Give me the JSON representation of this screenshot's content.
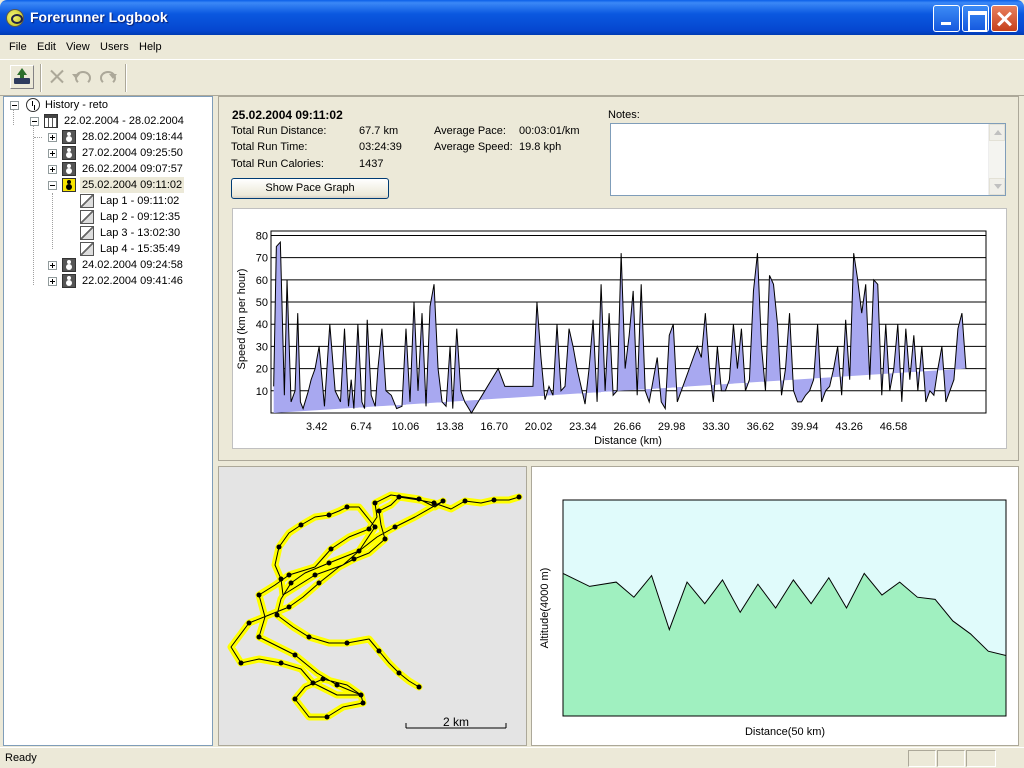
{
  "window": {
    "title": "Forerunner Logbook",
    "icon": "forerunner-app-icon"
  },
  "menu": [
    "File",
    "Edit",
    "View",
    "Users",
    "Help"
  ],
  "toolbar": {
    "buttons": [
      {
        "name": "upload-from-device",
        "icon": "upload-icon",
        "enabled": true
      },
      {
        "name": "delete",
        "icon": "delete-x-icon",
        "enabled": false
      },
      {
        "name": "undo",
        "icon": "undo-icon",
        "enabled": false
      },
      {
        "name": "redo",
        "icon": "redo-icon",
        "enabled": false
      }
    ]
  },
  "tree": {
    "root": "History - reto",
    "week": "22.02.2004 - 28.02.2004",
    "runs": [
      {
        "label": "28.02.2004 09:18:44",
        "expanded": false
      },
      {
        "label": "27.02.2004 09:25:50",
        "expanded": false
      },
      {
        "label": "26.02.2004 09:07:57",
        "expanded": false
      },
      {
        "label": "25.02.2004 09:11:02",
        "expanded": true,
        "selected": true
      },
      {
        "label": "24.02.2004 09:24:58",
        "expanded": false
      },
      {
        "label": "22.02.2004 09:41:46",
        "expanded": false
      }
    ],
    "laps": [
      "Lap 1 - 09:11:02",
      "Lap 2 - 09:12:35",
      "Lap 3 - 13:02:30",
      "Lap 4 - 15:35:49"
    ]
  },
  "details": {
    "title": "25.02.2004  09:11:02",
    "distance_label": "Total Run Distance:",
    "distance_value": "67.7 km",
    "time_label": "Total Run Time:",
    "time_value": "03:24:39",
    "calories_label": "Total Run Calories:",
    "calories_value": "1437",
    "pace_label": "Average Pace:",
    "pace_value": "00:03:01/km",
    "speed_label": "Average Speed:",
    "speed_value": "19.8 kph",
    "notes_label": "Notes:",
    "notes_value": "",
    "pace_button": "Show Pace Graph"
  },
  "map": {
    "scale_label": "2 km"
  },
  "status": {
    "text": "Ready"
  },
  "colors": {
    "speed_fill": "#a8a8f0",
    "speed_line": "#000000",
    "altitude_sky": "#e0fbfb",
    "altitude_fill": "#a0f0c0",
    "track": "#ffff00"
  },
  "chart_data": [
    {
      "type": "area",
      "title": "",
      "xlabel": "Distance (km)",
      "ylabel": "Speed (km per hour)",
      "ylim": [
        0,
        82
      ],
      "xlim": [
        0,
        53.5
      ],
      "grid": true,
      "yticks": [
        10,
        20,
        30,
        40,
        50,
        60,
        70,
        80
      ],
      "xticks": [
        "3.42",
        "6.74",
        "10.06",
        "13.38",
        "16.70",
        "20.02",
        "23.34",
        "26.66",
        "29.98",
        "33.30",
        "36.62",
        "39.94",
        "43.26",
        "46.58"
      ],
      "x": [
        0.2,
        0.4,
        0.7,
        1.0,
        1.2,
        1.5,
        1.8,
        2.0,
        2.2,
        2.4,
        2.6,
        2.8,
        3.0,
        3.3,
        3.6,
        4.0,
        4.4,
        4.8,
        5.2,
        5.5,
        5.8,
        6.0,
        6.2,
        6.5,
        6.8,
        7.0,
        7.2,
        7.5,
        7.8,
        8.0,
        8.3,
        8.6,
        9.0,
        9.4,
        9.8,
        10.1,
        10.4,
        10.7,
        11.0,
        11.3,
        11.6,
        11.9,
        12.2,
        12.5,
        12.8,
        13.1,
        13.4,
        13.6,
        13.9,
        14.2,
        14.5,
        15.0,
        15.5,
        16.0,
        16.5,
        17.0,
        17.5,
        18.0,
        18.6,
        19.2,
        19.6,
        19.9,
        20.2,
        20.5,
        20.8,
        21.1,
        21.4,
        21.7,
        22.0,
        22.3,
        22.6,
        22.9,
        23.2,
        23.5,
        23.8,
        24.1,
        24.4,
        24.7,
        25.0,
        25.3,
        25.6,
        25.9,
        26.2,
        26.5,
        26.8,
        27.1,
        27.4,
        27.7,
        28.0,
        28.3,
        28.6,
        28.9,
        29.2,
        29.5,
        29.8,
        30.1,
        30.4,
        30.7,
        31.0,
        31.3,
        31.6,
        31.9,
        32.2,
        32.5,
        32.8,
        33.1,
        33.4,
        33.7,
        34.0,
        34.3,
        34.6,
        34.9,
        35.2,
        35.5,
        35.8,
        36.1,
        36.4,
        36.7,
        37.0,
        37.3,
        37.6,
        37.9,
        38.2,
        38.5,
        38.8,
        39.1,
        39.4,
        39.7,
        40.0,
        40.3,
        40.6,
        40.9,
        41.2,
        41.5,
        41.8,
        42.1,
        42.4,
        42.7,
        43.0,
        43.3,
        43.6,
        43.9,
        44.2,
        44.5,
        44.8,
        45.1,
        45.4,
        45.7,
        46.0,
        46.3,
        46.6,
        46.9,
        47.2,
        47.5,
        47.8,
        48.1,
        48.4,
        48.7,
        49.0,
        49.3,
        49.6,
        49.9,
        50.2,
        50.5,
        50.8,
        51.1,
        51.4,
        51.7,
        52.0,
        52.3,
        52.6,
        52.9,
        53.2
      ],
      "series": [
        {
          "values": [
            12,
            75,
            77,
            8,
            60,
            5,
            10,
            45,
            5,
            2,
            6,
            10,
            15,
            20,
            30,
            3,
            40,
            10,
            5,
            38,
            3,
            15,
            2,
            40,
            5,
            2,
            42,
            8,
            3,
            20,
            38,
            10,
            8,
            2,
            3,
            38,
            5,
            50,
            10,
            45,
            3,
            48,
            58,
            20,
            5,
            3,
            30,
            2,
            38,
            10,
            5,
            0,
            5,
            10,
            15,
            20,
            12,
            12,
            12,
            12,
            12,
            50,
            25,
            6,
            12,
            8,
            40,
            10,
            12,
            38,
            30,
            20,
            12,
            4,
            20,
            42,
            5,
            58,
            10,
            45,
            8,
            10,
            72,
            20,
            35,
            55,
            8,
            58,
            10,
            5,
            15,
            25,
            5,
            2,
            35,
            40,
            5,
            10,
            15,
            20,
            25,
            30,
            25,
            45,
            20,
            5,
            30,
            10,
            10,
            15,
            40,
            20,
            38,
            10,
            15,
            55,
            72,
            30,
            10,
            62,
            58,
            40,
            8,
            20,
            45,
            10,
            5,
            5,
            8,
            10,
            15,
            40,
            5,
            10,
            12,
            20,
            30,
            8,
            42,
            15,
            72,
            60,
            45,
            58,
            15,
            60,
            58,
            8,
            40,
            10,
            20,
            40,
            5,
            38,
            15,
            35,
            10,
            30,
            5,
            10,
            8,
            20,
            30,
            5,
            10,
            15,
            38,
            45,
            20
          ]
        }
      ]
    },
    {
      "type": "area",
      "title": "",
      "xlabel": "Distance(50 km)",
      "ylabel": "Altitude(4000 m)",
      "grid": false,
      "x": [
        0,
        0.06,
        0.12,
        0.16,
        0.2,
        0.24,
        0.28,
        0.32,
        0.36,
        0.4,
        0.44,
        0.48,
        0.52,
        0.56,
        0.6,
        0.64,
        0.68,
        0.72,
        0.76,
        0.8,
        0.84,
        0.88,
        0.92,
        0.96,
        1.0
      ],
      "series": [
        {
          "values": [
            0.66,
            0.6,
            0.62,
            0.55,
            0.65,
            0.4,
            0.62,
            0.52,
            0.63,
            0.48,
            0.61,
            0.5,
            0.63,
            0.52,
            0.64,
            0.5,
            0.66,
            0.56,
            0.62,
            0.55,
            0.54,
            0.44,
            0.38,
            0.3,
            0.28
          ]
        }
      ]
    }
  ]
}
